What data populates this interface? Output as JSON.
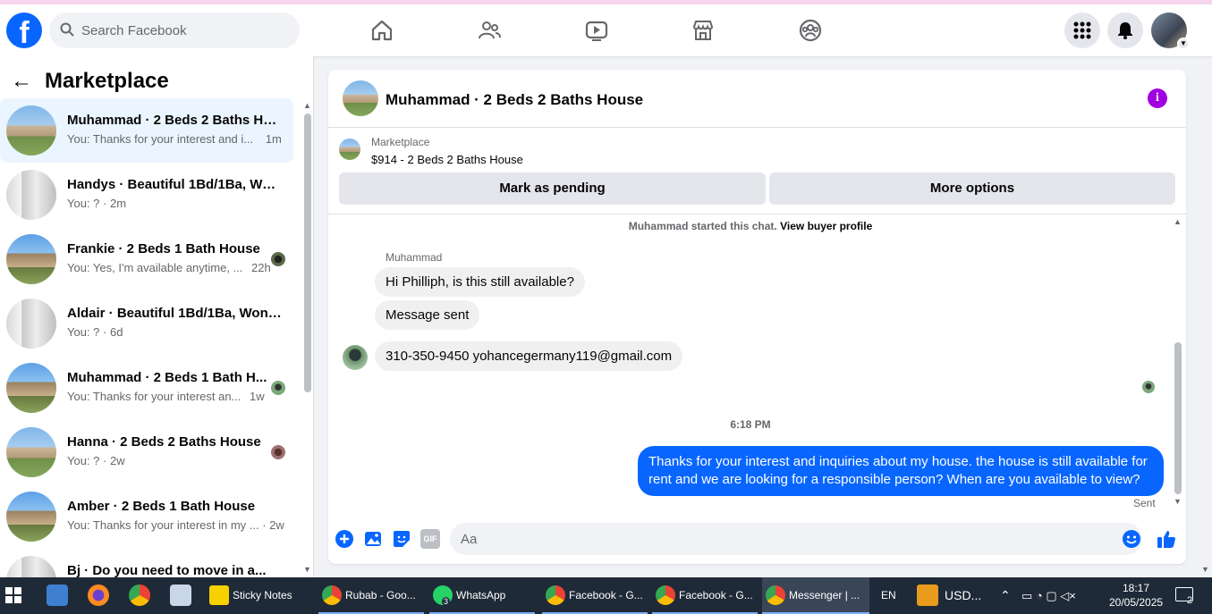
{
  "topbar": {
    "logo": "f",
    "search_placeholder": "Search Facebook",
    "nav_icons": [
      "home-icon",
      "friends-icon",
      "video-icon",
      "marketplace-icon",
      "groups-icon"
    ],
    "right_icons": [
      "menu-grid-icon",
      "bell-icon",
      "profile-avatar"
    ]
  },
  "sidebar": {
    "back": "←",
    "title": "Marketplace",
    "conversations": [
      {
        "title": "Muhammad · 2 Beds 2 Baths Ho...",
        "preview": "You: Thanks for your interest and i...",
        "time": "1m"
      },
      {
        "title": "Handys · Beautiful 1Bd/1Ba, Won...",
        "preview": "You: ?",
        "time": "2m"
      },
      {
        "title": "Frankie · 2 Beds 1 Bath House",
        "preview": "You: Yes, I'm available anytime, ...",
        "time": "22h"
      },
      {
        "title": "Aldair · Beautiful 1Bd/1Ba, Wond...",
        "preview": "You: ?",
        "time": "6d"
      },
      {
        "title": "Muhammad · 2 Beds 1 Bath H...",
        "preview": "You: Thanks for your interest an...",
        "time": "1w"
      },
      {
        "title": "Hanna · 2 Beds 2 Baths House",
        "preview": "You: ?",
        "time": "2w"
      },
      {
        "title": "Amber · 2 Beds 1 Bath House",
        "preview": "You: Thanks for your interest in my ...",
        "time": "2w"
      },
      {
        "title": "Bj · Do you need to move in a...",
        "preview": "",
        "time": ""
      }
    ]
  },
  "chat": {
    "header_title": "Muhammad · 2 Beds 2 Baths House",
    "info": "i",
    "marketplace_label": "Marketplace",
    "listing": "$914 - 2 Beds 2 Baths House",
    "mark_pending": "Mark as pending",
    "more_options": "More options",
    "started_text": "Muhammad started this chat.",
    "view_buyer": "View buyer profile",
    "sender_name": "Muhammad",
    "messages_in": [
      "Hi Philliph, is this still available?",
      "Message sent",
      "310-350-9450 yohancegermany119@gmail.com"
    ],
    "timestamp": "6:18 PM",
    "message_out": "Thanks for your interest and inquiries about my house. the house is still available for rent and we are looking for a responsible person? When are you available to view?",
    "sent_label": "Sent",
    "composer_placeholder": "Aa",
    "gif": "GIF"
  },
  "taskbar": {
    "apps": [
      {
        "label": "Sticky Notes"
      },
      {
        "label": "Rubab - Goo..."
      },
      {
        "label": "WhatsApp"
      },
      {
        "label": "Facebook - G..."
      },
      {
        "label": "Facebook - G..."
      },
      {
        "label": "Messenger | ..."
      }
    ],
    "whatsapp_badge": "3",
    "lang": "EN",
    "currency": "USD...",
    "time": "18:17",
    "date": "20/05/2025",
    "notif_count": "2"
  },
  "colors": {
    "brand": "#0866ff",
    "info": "#a100e0",
    "taskbar": "#1f2a38"
  }
}
